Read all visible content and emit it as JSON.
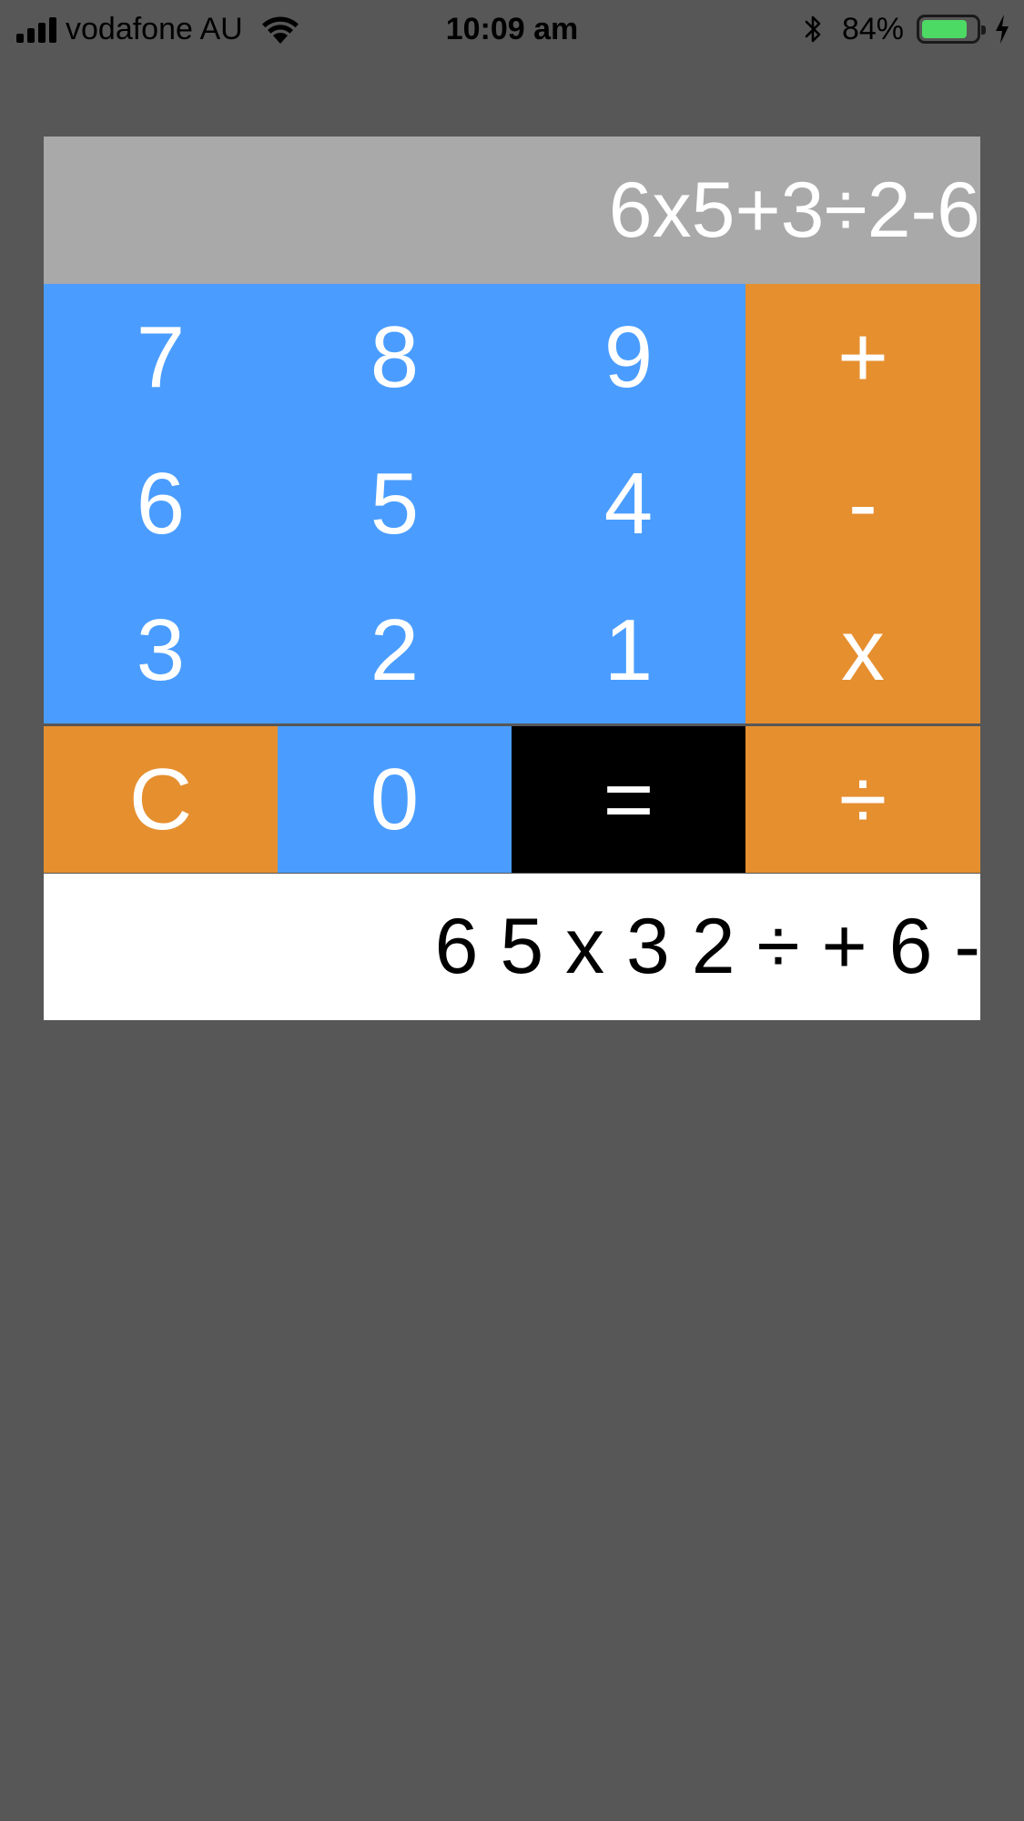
{
  "status_bar": {
    "carrier": "vodafone AU",
    "time": "10:09 am",
    "battery_percent": "84%",
    "battery_level": 0.84,
    "battery_color": "#4cd964"
  },
  "calculator": {
    "display": "6x5+3÷2-6",
    "history": "6 5 x 3 2 ÷ + 6 -",
    "keys": {
      "k7": "7",
      "k8": "8",
      "k9": "9",
      "plus": "+",
      "k6": "6",
      "k5": "5",
      "k4": "4",
      "minus": "-",
      "k3": "3",
      "k2": "2",
      "k1": "1",
      "times": "x",
      "clear": "C",
      "k0": "0",
      "equals": "=",
      "divide": "÷"
    },
    "colors": {
      "digit": "#4a9dff",
      "operator": "#e68f2f",
      "equals": "#000000",
      "display_bg": "#a9a9a9",
      "background": "#575757"
    }
  }
}
